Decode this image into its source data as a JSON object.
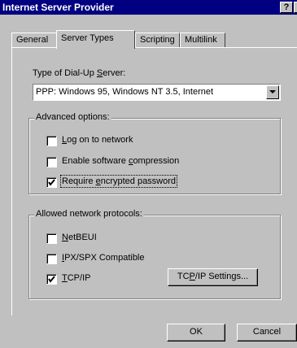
{
  "window": {
    "title": "Internet Server Provider",
    "help_btn": "?",
    "close_btn": "X"
  },
  "tabs": [
    {
      "label": "General",
      "active": false
    },
    {
      "label": "Server Types",
      "active": true
    },
    {
      "label": "Scripting",
      "active": false
    },
    {
      "label": "Multilink",
      "active": false
    }
  ],
  "dialup": {
    "label_pre": "Type of Dial-Up ",
    "label_key": "S",
    "label_post": "erver:",
    "selected": "PPP: Windows 95, Windows NT 3.5, Internet"
  },
  "advanced": {
    "title": "Advanced options:",
    "options": [
      {
        "pre": "",
        "key": "L",
        "post": "og on to network",
        "checked": false
      },
      {
        "pre": "Enable software ",
        "key": "c",
        "post": "ompression",
        "checked": false
      },
      {
        "pre": "Require ",
        "key": "e",
        "post": "ncrypted password",
        "checked": true
      }
    ]
  },
  "protocols": {
    "title": "Allowed network protocols:",
    "options": [
      {
        "pre": "",
        "key": "N",
        "post": "etBEUI",
        "checked": false
      },
      {
        "pre": "",
        "key": "I",
        "post": "PX/SPX Compatible",
        "checked": false
      },
      {
        "pre": "",
        "key": "T",
        "post": "CP/IP",
        "checked": true
      }
    ],
    "tcpip_settings_pre": "TC",
    "tcpip_settings_key": "P",
    "tcpip_settings_post": "/IP Settings..."
  },
  "buttons": {
    "ok": "OK",
    "cancel": "Cancel"
  }
}
